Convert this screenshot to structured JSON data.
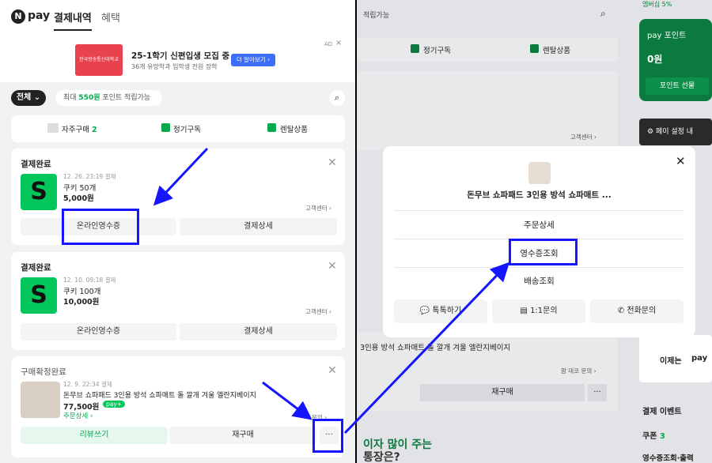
{
  "left": {
    "logo_text": "pay",
    "logo_letter": "N",
    "tabs": [
      "결제내역",
      "혜택"
    ],
    "ad": {
      "title": "25-1학기 신편입생 모집 중",
      "sub": "36개 유망학과 입학생 전원 장학",
      "cta": "더 알아보기 ›",
      "badge": "AD",
      "thumb_text": "한국방송통신대학교"
    },
    "filter": {
      "all": "전체",
      "points_prefix": "최대 ",
      "points_amount": "550원",
      "points_suffix": " 포인트 적립가능"
    },
    "shortcuts": [
      {
        "label": "자주구매",
        "count": "2"
      },
      {
        "label": "정기구독"
      },
      {
        "label": "렌탈상품"
      }
    ],
    "orders": [
      {
        "status": "결제완료",
        "date": "12. 26. 23:19 결제",
        "item": "쿠키 50개",
        "price": "5,000원",
        "cs": "고객센터 ›",
        "b1": "온라인영수증",
        "b2": "결제상세"
      },
      {
        "status": "결제완료",
        "date": "12. 10. 09:18 결제",
        "item": "쿠키 100개",
        "price": "10,000원",
        "cs": "고객센터 ›",
        "b1": "온라인영수증",
        "b2": "결제상세"
      },
      {
        "status": "구매확정완료",
        "date": "12. 9. 22:34 결제",
        "item": "돈무브 쇼파패드 3인용 방석 쇼파매트 돌 깔개 겨울 엘란지베이지",
        "price": "77,500원",
        "pay": "pay+",
        "detail": "주문상세 ›",
        "cs": "문의 ›",
        "b1": "리뷰쓰기",
        "b2": "재구매",
        "more": "···"
      }
    ]
  },
  "right": {
    "search_hint": "적립가능",
    "shortcuts": [
      "정기구독",
      "렌탈상품"
    ],
    "cs": "고객센터 ›",
    "product_line": "3인용 방석 쇼파매트 돌 깔개 겨울 엘란지베이지",
    "dec_cs": "팜 데코 문의 ›",
    "rebuy": "재구매",
    "more": "···",
    "promo": "이자 많이 주는",
    "promo2": "통장은?",
    "side": {
      "top": "엠버십 5%",
      "point_title": "pay 포인트",
      "point_value": "0원",
      "point_btn": "포인트 선물",
      "settings": "페이 설정 내",
      "now": "이제는",
      "pay": "pay",
      "event": "결제 이벤트",
      "coupon": "쿠폰",
      "coupon_count": "3",
      "receipt": "영수증조회·출력"
    },
    "popup": {
      "title": "돈무브 쇼파패드 3인용 방석 쇼파매트 ...",
      "menu": [
        "주문상세",
        "영수증조회",
        "배송조회"
      ],
      "actions": [
        "톡톡하기",
        "1:1문의",
        "전화문의"
      ]
    }
  }
}
